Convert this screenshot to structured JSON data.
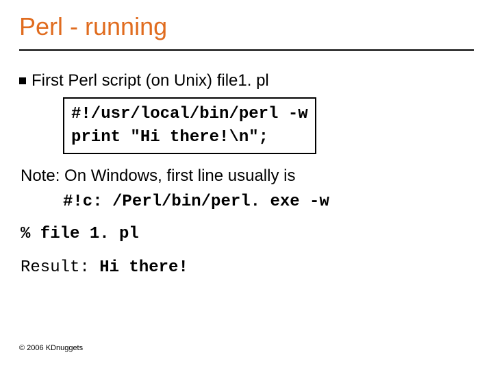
{
  "title": "Perl - running",
  "bullet": "First Perl script (on Unix) file1. pl",
  "code_box": {
    "line1": "#!/usr/local/bin/perl -w",
    "line2": "print \"Hi there!\\n\";"
  },
  "note": "Note: On Windows, first line usually is",
  "windows_code": "#!c: /Perl/bin/perl. exe -w",
  "command": "% file 1. pl",
  "result_label": "Result: ",
  "result_value": "Hi there!",
  "copyright": "© 2006 KDnuggets"
}
